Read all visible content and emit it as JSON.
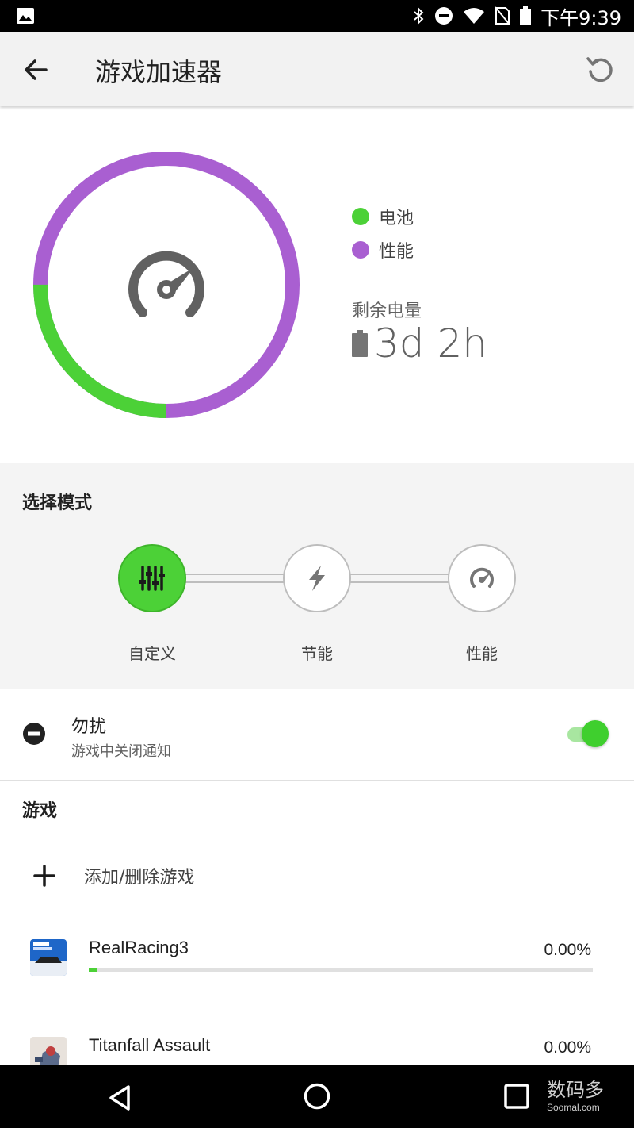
{
  "status_bar": {
    "time": "下午9:39",
    "icons": [
      "gallery-icon",
      "bluetooth-icon",
      "dnd-icon",
      "wifi-icon",
      "no-sim-icon",
      "battery-icon"
    ]
  },
  "app_bar": {
    "title": "游戏加速器",
    "back_icon": "back-arrow-icon",
    "refresh_icon": "refresh-icon"
  },
  "dashboard": {
    "legend": [
      {
        "label": "电池",
        "color": "#4cd137"
      },
      {
        "label": "性能",
        "color": "#a95fd1"
      }
    ],
    "ring": {
      "battery_fraction": 0.25,
      "performance_fraction": 0.75
    },
    "remaining_label": "剩余电量",
    "remaining_value": "3d 2h"
  },
  "mode": {
    "title": "选择模式",
    "options": [
      {
        "label": "自定义",
        "icon": "sliders-icon",
        "active": true
      },
      {
        "label": "节能",
        "icon": "lightning-icon",
        "active": false
      },
      {
        "label": "性能",
        "icon": "speedometer-icon",
        "active": false
      }
    ]
  },
  "dnd": {
    "title": "勿扰",
    "subtitle": "游戏中关闭通知",
    "enabled": true
  },
  "games": {
    "title": "游戏",
    "add_label": "添加/删除游戏",
    "list": [
      {
        "name": "RealRacing3",
        "percent": "0.00%",
        "progress": 0.015
      },
      {
        "name": "Titanfall Assault",
        "percent": "0.00%",
        "progress": 0.0
      }
    ]
  },
  "watermark": {
    "main": "数码多",
    "sub": "Soomal.com"
  },
  "colors": {
    "accent": "#4cd137",
    "performance": "#a95fd1"
  }
}
